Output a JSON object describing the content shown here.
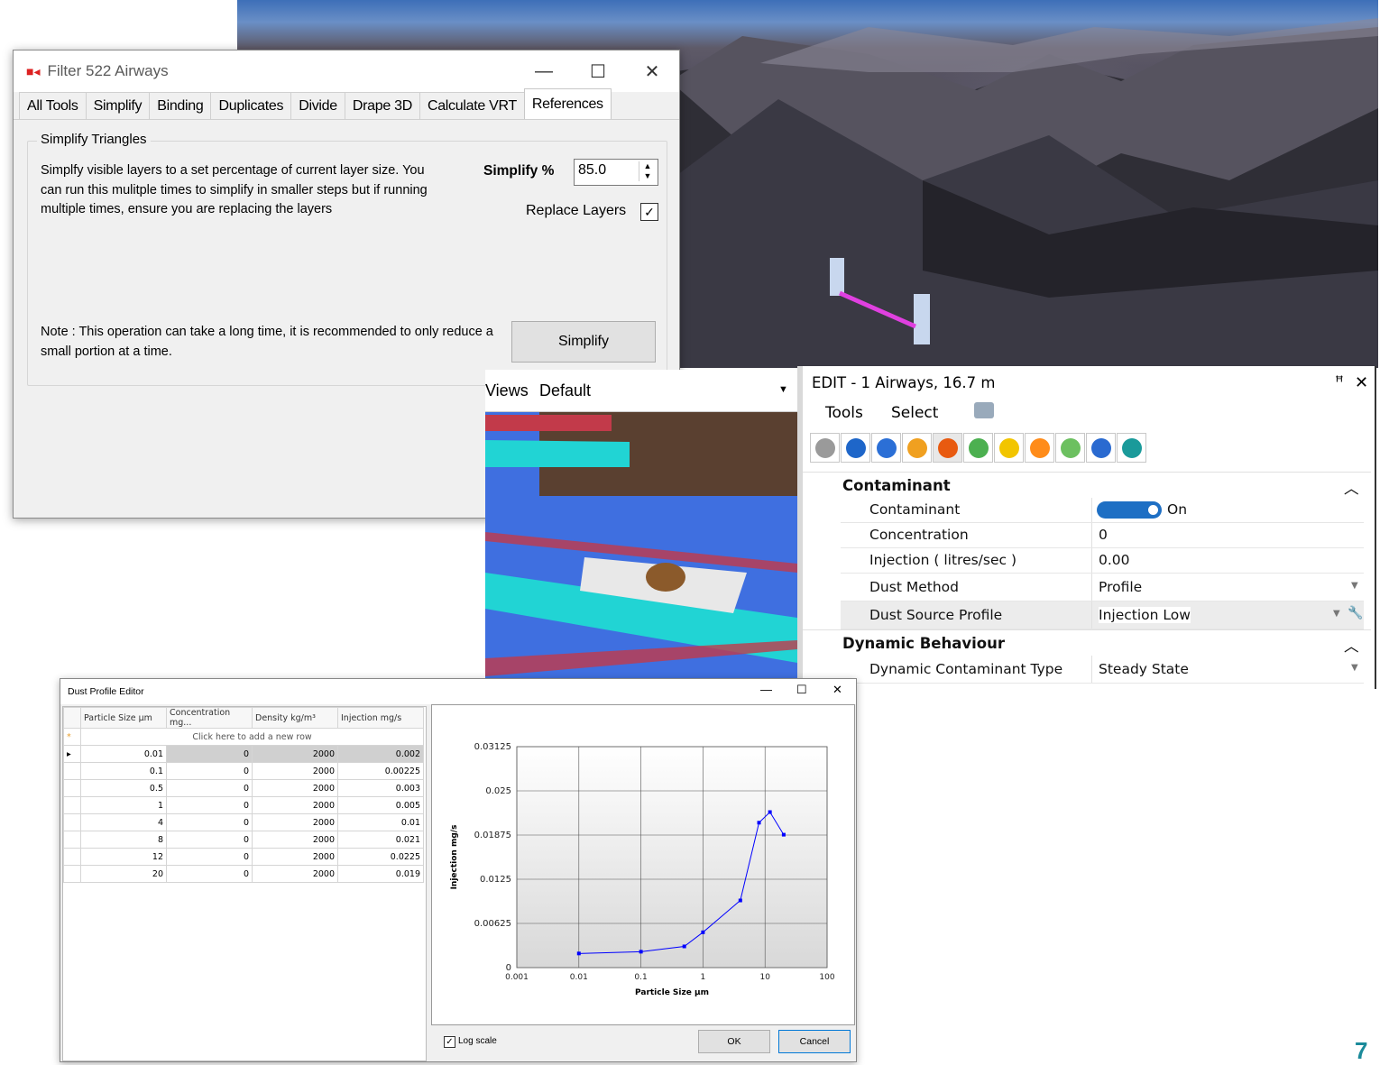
{
  "filter_window": {
    "title": "Filter 522 Airways",
    "tabs": [
      "All Tools",
      "Simplify",
      "Binding",
      "Duplicates",
      "Divide",
      "Drape 3D",
      "Calculate VRT",
      "References"
    ],
    "active_tab": "References",
    "group_label": "Simplify Triangles",
    "description": "Simplfy visible layers to a set percentage of current layer size.  You can run this mulitple times to simplify in smaller steps but if running multiple times, ensure you are replacing the layers",
    "simplify_label": "Simplify %",
    "simplify_value": "85.0",
    "replace_layers_label": "Replace Layers",
    "replace_layers_checked": true,
    "note": "Note : This operation can take a long time, it is recommended to only reduce a small portion at a time.",
    "simplify_button": "Simplify"
  },
  "views_panel": {
    "label": "Views",
    "selected_view": "Default"
  },
  "edit_panel": {
    "title": "EDIT -  1 Airways, 16.7 m",
    "menu": [
      "Tools",
      "Select"
    ],
    "icons": [
      "globe-icon",
      "info-icon",
      "fan-icon",
      "heat-icon",
      "fire-icon",
      "chat-icon",
      "radiation-icon",
      "flame-icon",
      "wifi-icon",
      "tag-icon",
      "vl-icon"
    ],
    "sections": [
      {
        "title": "Contaminant",
        "rows": [
          {
            "name": "Contaminant",
            "value": "On"
          },
          {
            "name": "Concentration",
            "value": "0"
          },
          {
            "name": "Injection ( litres/sec )",
            "value": "0.00"
          },
          {
            "name": "Dust Method",
            "value": "Profile"
          },
          {
            "name": "Dust Source Profile",
            "value": "Injection Low"
          }
        ]
      },
      {
        "title": "Dynamic Behaviour",
        "rows": [
          {
            "name": "Dynamic Contaminant Type",
            "value": "Steady State"
          }
        ]
      }
    ]
  },
  "dust_editor": {
    "title": "Dust Profile Editor",
    "columns": [
      "Particle Size  µm",
      "Concentration  mg...",
      "Density  kg/m³",
      "Injection  mg/s"
    ],
    "new_row_text": "Click here to add a new row",
    "rows": [
      [
        "0.01",
        "0",
        "2000",
        "0.002"
      ],
      [
        "0.1",
        "0",
        "2000",
        "0.00225"
      ],
      [
        "0.5",
        "0",
        "2000",
        "0.003"
      ],
      [
        "1",
        "0",
        "2000",
        "0.005"
      ],
      [
        "4",
        "0",
        "2000",
        "0.01"
      ],
      [
        "8",
        "0",
        "2000",
        "0.021"
      ],
      [
        "12",
        "0",
        "2000",
        "0.0225"
      ],
      [
        "20",
        "0",
        "2000",
        "0.019"
      ]
    ],
    "log_scale_label": "Log scale",
    "log_scale_checked": true,
    "ok_button": "OK",
    "cancel_button": "Cancel"
  },
  "chart_data": {
    "type": "line",
    "xlabel": "Particle Size  µm",
    "ylabel": "Injection  mg/s",
    "xscale": "log",
    "xlim": [
      0.001,
      100
    ],
    "ylim": [
      0,
      0.03125
    ],
    "x_ticks": [
      "0.001",
      "0.01",
      "0.1",
      "1",
      "10",
      "100"
    ],
    "y_ticks": [
      "0",
      "0.00625",
      "0.0125",
      "0.01875",
      "0.025",
      "0.03125"
    ],
    "grid": true,
    "series": [
      {
        "x": [
          0.01,
          0.1,
          0.5,
          1,
          4,
          8,
          12,
          20
        ],
        "y": [
          0.002,
          0.00225,
          0.003,
          0.005,
          0.0095,
          0.0205,
          0.022,
          0.0188
        ],
        "color": "#0000ff"
      }
    ]
  },
  "page_number": "7"
}
